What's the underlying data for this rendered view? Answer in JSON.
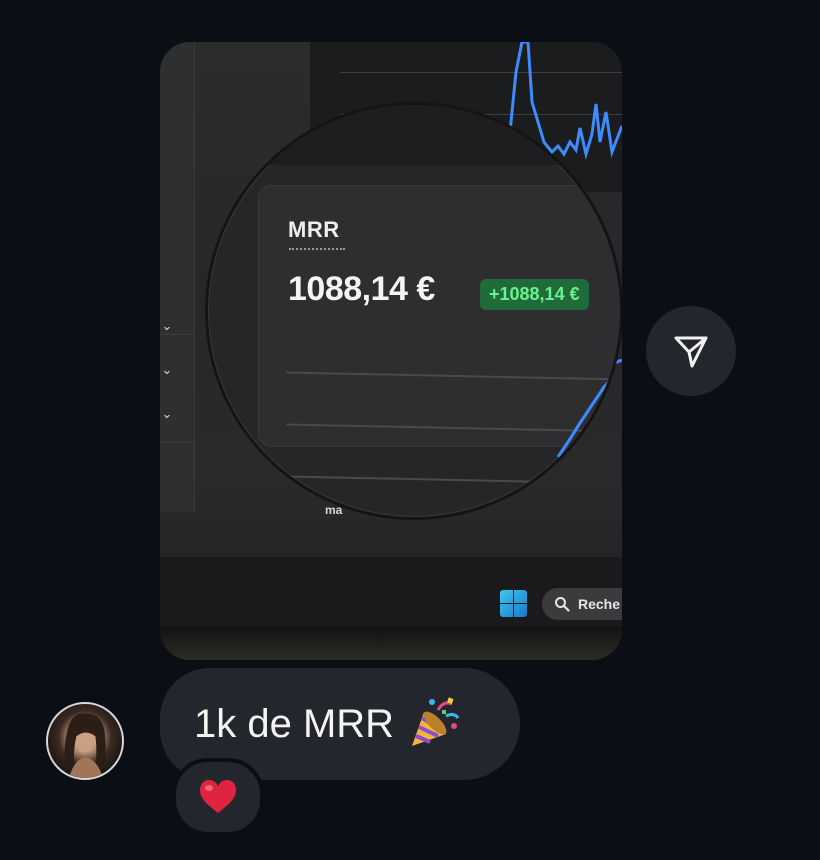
{
  "photo": {
    "mrr_label": "MRR",
    "mrr_value": "1088,14 €",
    "mrr_change": "+1088,14 €",
    "taskbar_search_text": "Reche",
    "partial_label": "ma"
  },
  "message": {
    "text": "1k de MRR",
    "emoji": "party-popper-icon",
    "reaction": "heart-icon"
  },
  "colors": {
    "background": "#0b0e14",
    "bubble": "#23262d",
    "badge_bg": "#1f6b3a",
    "badge_text": "#6bf08f",
    "chart_line": "#3d8bff",
    "heart": "#e0243f"
  }
}
